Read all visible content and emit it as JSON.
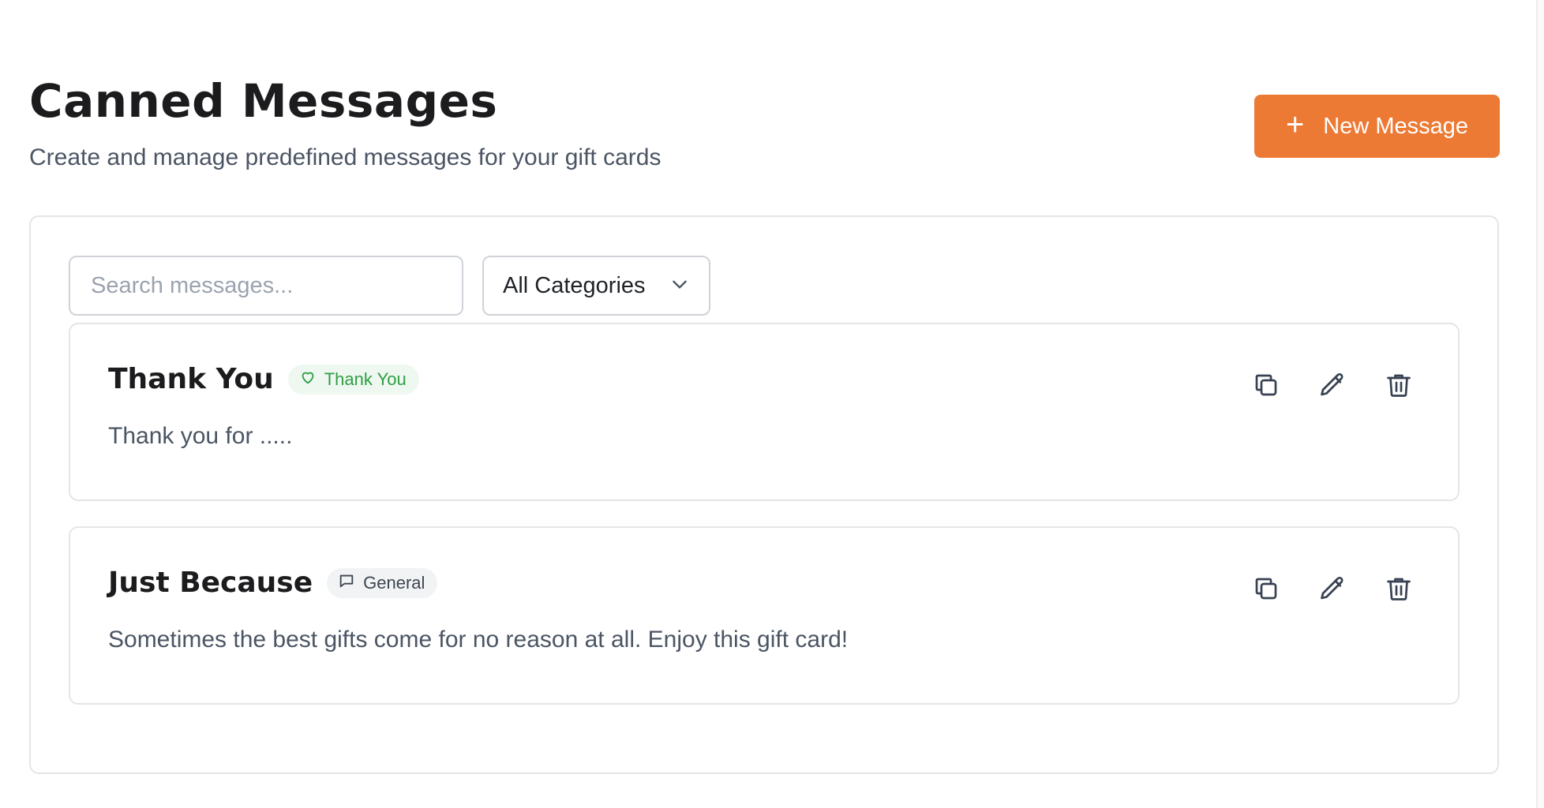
{
  "header": {
    "title": "Canned Messages",
    "subtitle": "Create and manage predefined messages for your gift cards",
    "new_button_label": "New Message"
  },
  "filters": {
    "search_placeholder": "Search messages...",
    "search_value": "",
    "category_selected": "All Categories"
  },
  "messages": [
    {
      "title": "Thank You",
      "category": "Thank You",
      "category_icon": "heart-icon",
      "category_color": "#2f9e44",
      "body": "Thank you for ....."
    },
    {
      "title": "Just Because",
      "category": "General",
      "category_icon": "chat-bubble-icon",
      "category_color": "#3f4650",
      "body": "Sometimes the best gifts come for no reason at all. Enjoy this gift card!"
    }
  ],
  "colors": {
    "accent": "#ec7a34",
    "border": "#e3e5e8"
  }
}
